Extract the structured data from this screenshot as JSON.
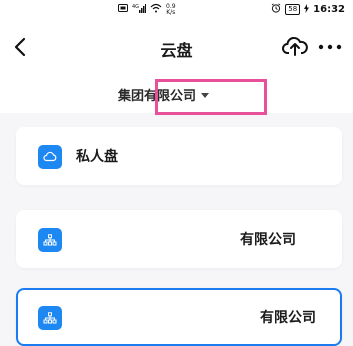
{
  "status_bar": {
    "net_speed_value": "0.9",
    "net_speed_unit": "K/s",
    "battery": "58",
    "time": "16:32"
  },
  "nav": {
    "title": "云盘"
  },
  "selector": {
    "label": "集团有限公司"
  },
  "cards": [
    {
      "label": "私人盘",
      "icon": "cloud-icon"
    },
    {
      "label": "有限公司",
      "icon": "org-chart-icon"
    },
    {
      "label": "有限公司",
      "icon": "org-chart-icon",
      "selected": true
    }
  ],
  "colors": {
    "accent": "#1a7cf0",
    "icon_bg": "#1e88f2",
    "highlight": "#e8509a",
    "background": "#f6f6f8"
  }
}
